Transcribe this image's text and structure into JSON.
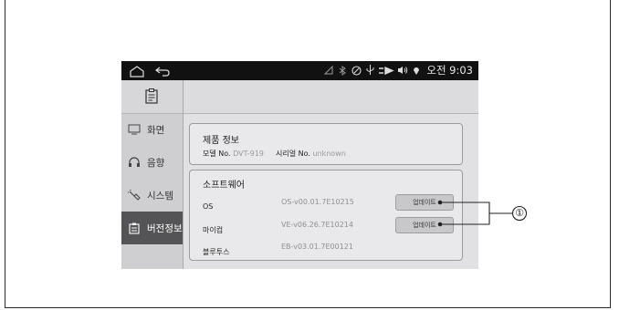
{
  "statusbar": {
    "time": "오전 9:03",
    "icons": [
      "home-icon",
      "back-icon",
      "signal-icon",
      "bluetooth-icon",
      "gps-icon",
      "usb-icon",
      "media-icon",
      "volume-icon",
      "location-icon"
    ]
  },
  "sidebar": {
    "items": [
      {
        "label": "화면",
        "icon": "display-icon"
      },
      {
        "label": "음향",
        "icon": "headphones-icon"
      },
      {
        "label": "시스템",
        "icon": "wrench-icon"
      },
      {
        "label": "버전정보",
        "icon": "clipboard-icon",
        "active": true
      }
    ]
  },
  "product": {
    "title": "제품 정보",
    "model_label": "모델 No.",
    "model_value": "DVT-919",
    "serial_label": "시리얼 No.",
    "serial_value": "unknown"
  },
  "software": {
    "title": "소프트웨어",
    "rows": [
      {
        "name": "OS",
        "version": "OS-v00.01.7E10215",
        "button": "업데이트"
      },
      {
        "name": "마이컴",
        "version": "VE-v06.26.7E10214",
        "button": "업데이트"
      },
      {
        "name": "블루투스",
        "version": "EB-v03.01.7E00121"
      }
    ]
  },
  "callout": {
    "label": "①"
  }
}
